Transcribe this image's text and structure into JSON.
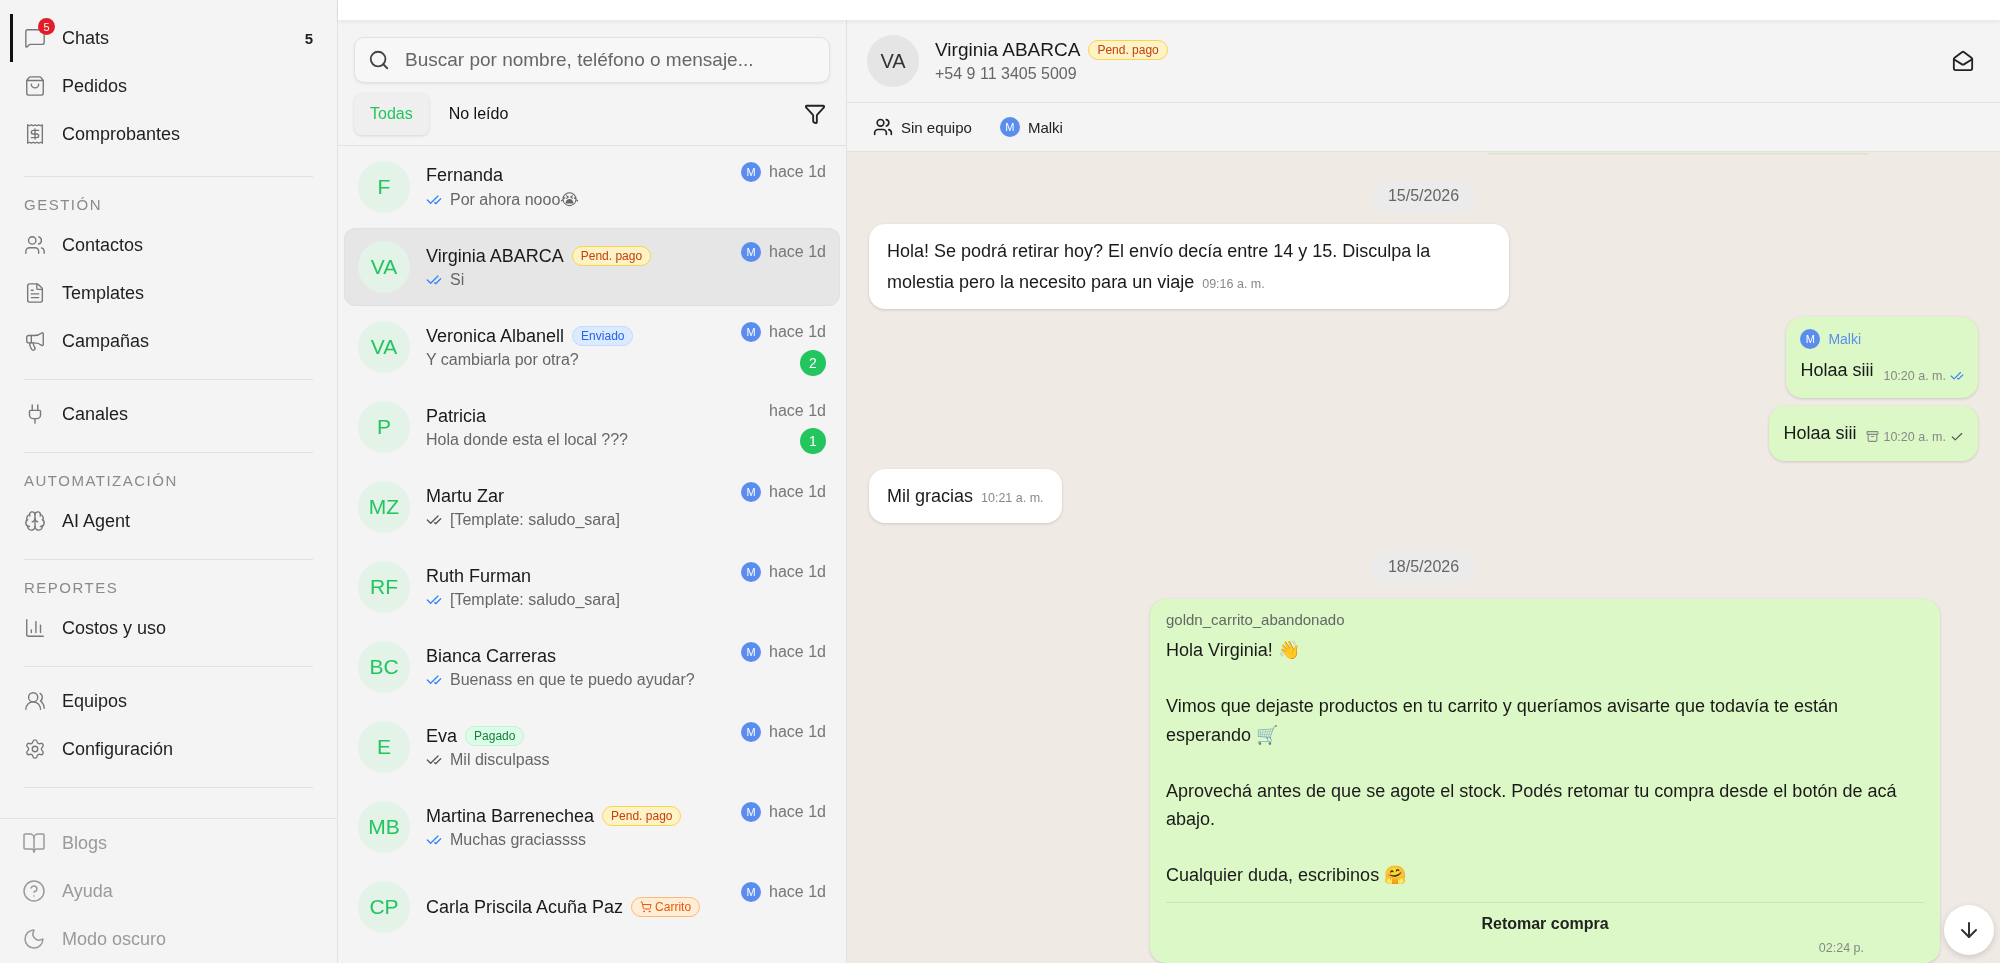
{
  "sidebar": {
    "groups": [
      {
        "items": [
          {
            "label": "Chats",
            "selected": true,
            "badge": "5",
            "count": "5"
          },
          {
            "label": "Pedidos",
            "selected": false
          },
          {
            "label": "Comprobantes",
            "selected": false
          }
        ]
      },
      {
        "heading": "GESTIÓN",
        "items": [
          {
            "label": "Contactos",
            "selected": false
          },
          {
            "label": "Templates",
            "selected": false
          },
          {
            "label": "Campañas",
            "selected": false
          }
        ]
      },
      {
        "items": [
          {
            "label": "Canales",
            "selected": false
          }
        ]
      },
      {
        "heading": "AUTOMATIZACIÓN",
        "items": [
          {
            "label": "AI Agent",
            "selected": false
          }
        ]
      },
      {
        "heading": "REPORTES",
        "items": [
          {
            "label": "Costos y uso",
            "selected": false
          }
        ]
      },
      {
        "items": [
          {
            "label": "Equipos",
            "selected": false
          },
          {
            "label": "Configuración",
            "selected": false
          }
        ]
      }
    ],
    "footer": [
      {
        "label": "Blogs",
        "muted": true
      },
      {
        "label": "Ayuda",
        "muted": true
      },
      {
        "label": "Modo oscuro",
        "muted": true
      }
    ]
  },
  "chat_list": {
    "search": {
      "placeholder": "Buscar por nombre, teléfono o mensaje..."
    },
    "tabs": [
      {
        "label": "Todas",
        "selected": true
      },
      {
        "label": "No leído",
        "selected": false
      }
    ],
    "chats": [
      {
        "initials": "F",
        "name": "Fernanda",
        "preview": "Por ahora nooo😭",
        "read": true,
        "agent": "M",
        "time": "hace 1d",
        "selected": false
      },
      {
        "initials": "VA",
        "name": "Virginia ABARCA",
        "tag": {
          "text": "Pend. pago",
          "kind": "pending"
        },
        "preview": "Si",
        "read": true,
        "agent": "M",
        "time": "hace 1d",
        "selected": true
      },
      {
        "initials": "VA",
        "name": "Veronica Albanell",
        "tag": {
          "text": "Enviado",
          "kind": "sent"
        },
        "preview": "Y cambiarla por otra?",
        "agent": "M",
        "time": "hace 1d",
        "unread": "2",
        "selected": false
      },
      {
        "initials": "P",
        "name": "Patricia",
        "preview": "Hola donde esta el local ???",
        "time": "hace 1d",
        "unread": "1",
        "selected": false
      },
      {
        "initials": "MZ",
        "name": "Martu Zar",
        "preview": "[Template: saludo_sara]",
        "read": false,
        "agent": "M",
        "time": "hace 1d",
        "selected": false
      },
      {
        "initials": "RF",
        "name": "Ruth Furman",
        "preview": "[Template: saludo_sara]",
        "read": true,
        "agent": "M",
        "time": "hace 1d",
        "selected": false
      },
      {
        "initials": "BC",
        "name": "Bianca Carreras",
        "preview": "Buenass en que te puedo ayudar?",
        "read": true,
        "agent": "M",
        "time": "hace 1d",
        "selected": false
      },
      {
        "initials": "E",
        "name": "Eva",
        "tag": {
          "text": "Pagado",
          "kind": "paid"
        },
        "preview": "Mil disculpass",
        "read": false,
        "agent": "M",
        "time": "hace 1d",
        "selected": false
      },
      {
        "initials": "MB",
        "name": "Martina Barrenechea",
        "tag": {
          "text": "Pend. pago",
          "kind": "pending"
        },
        "preview": "Muchas graciassss",
        "read": true,
        "agent": "M",
        "time": "hace 1d",
        "selected": false
      },
      {
        "initials": "CP",
        "name": "Carla Priscila Acuña Paz",
        "tag": {
          "text": "Carrito",
          "kind": "cart"
        },
        "agent": "M",
        "time": "hace 1d",
        "selected": false
      }
    ]
  },
  "conversation": {
    "header": {
      "initials": "VA",
      "name": "Virginia ABARCA",
      "tag": {
        "text": "Pend. pago",
        "kind": "pending"
      },
      "phone": "+54 9 11 3405 5009"
    },
    "team": {
      "label": "Sin equipo",
      "agent_initial": "M",
      "agent": "Malki"
    },
    "messages": [
      {
        "kind": "cut"
      },
      {
        "kind": "date",
        "text": "15/5/2026"
      },
      {
        "kind": "in",
        "text": "Hola! Se podrá retirar hoy? El envío decía entre 14 y 15. Disculpa la molestia pero la necesito para un viaje",
        "time": "09:16 a. m."
      },
      {
        "kind": "out",
        "sender_initial": "M",
        "sender": "Malki",
        "text": "Holaa siii",
        "time": "10:20 a. m.",
        "read": true,
        "double_tick": true
      },
      {
        "kind": "out",
        "text": "Holaa siii",
        "time": "10:20 a. m.",
        "read": false,
        "double_tick": false,
        "archived": true
      },
      {
        "kind": "in",
        "text": "Mil gracias",
        "time": "10:21 a. m."
      },
      {
        "kind": "date",
        "text": "18/5/2026"
      },
      {
        "kind": "template",
        "title": "goldn_carrito_abandonado",
        "paragraphs": [
          "Hola Virginia! 👋",
          "Vimos que dejaste productos en tu carrito y queríamos avisarte que todavía te están esperando 🛒",
          "Aprovechá antes de que se agote el stock. Podés retomar tu compra desde el botón de acá abajo.",
          "Cualquier duda, escribinos 🤗"
        ],
        "button": "Retomar compra",
        "time": "02:24 p."
      }
    ]
  }
}
